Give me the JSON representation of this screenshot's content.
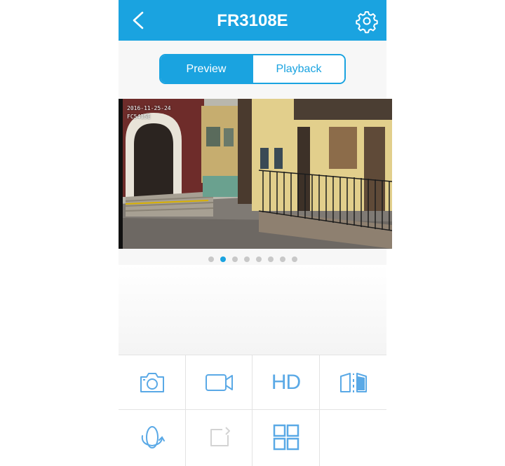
{
  "header": {
    "title": "FR3108E",
    "back_icon": "back-icon",
    "settings_icon": "gear-icon"
  },
  "tabs": [
    {
      "label": "Preview",
      "active": true
    },
    {
      "label": "Playback",
      "active": false
    }
  ],
  "video": {
    "osd_date": "2016-11-25-24",
    "osd_channel": "FC5415E"
  },
  "pager": {
    "total": 8,
    "active_index": 1
  },
  "controls": {
    "snapshot_icon": "camera-icon",
    "record_icon": "video-record-icon",
    "quality_label": "HD",
    "mirror_icon": "mirror-flip-icon",
    "rotate_icon": "rotate-icon",
    "share_icon": "share-icon",
    "layout_icon": "grid-layout-icon"
  },
  "colors": {
    "accent": "#1aa3e0",
    "icon": "#5aa9e6",
    "dot_inactive": "#c8c8c8"
  }
}
